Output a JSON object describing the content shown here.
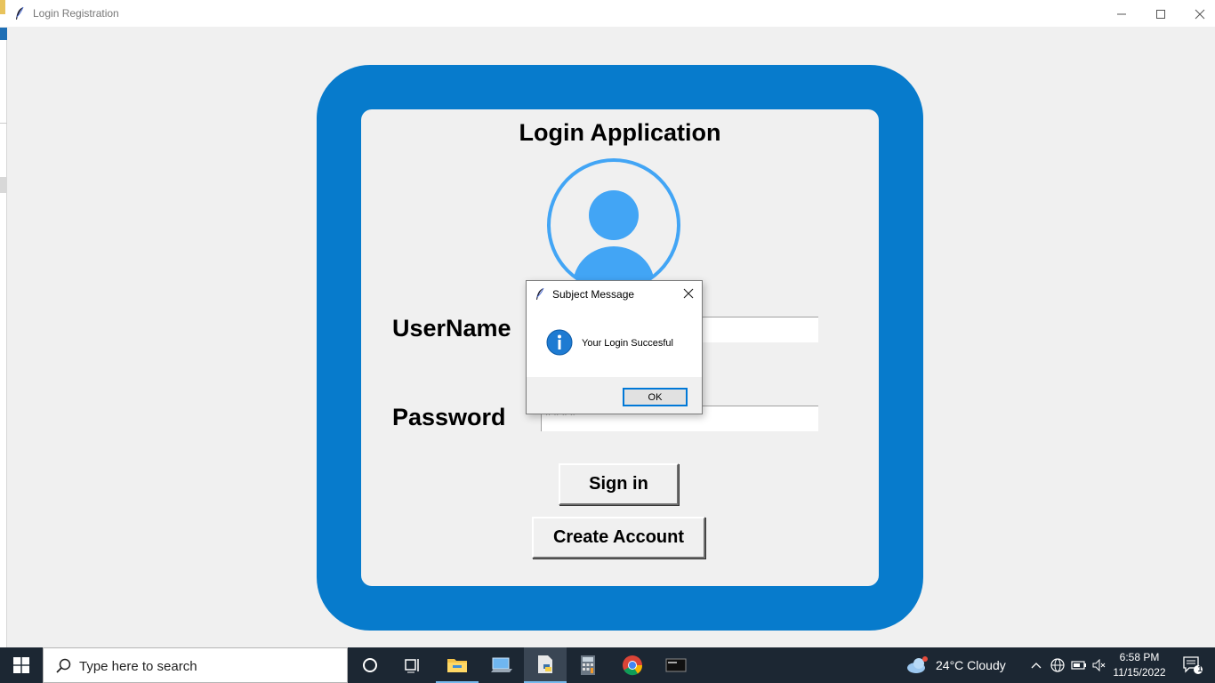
{
  "window": {
    "title": "Login Registration"
  },
  "app": {
    "heading": "Login Application",
    "username_label": "UserName",
    "password_label": "Password",
    "username_value": "",
    "password_value": "****",
    "signin_label": "Sign in",
    "create_label": "Create Account"
  },
  "dialog": {
    "title": "Subject Message",
    "message": "Your Login Succesful",
    "ok_label": "OK"
  },
  "taskbar": {
    "search_placeholder": "Type here to search",
    "weather": "24°C  Cloudy",
    "time": "6:58 PM",
    "date": "11/15/2022",
    "notification_count": "1"
  },
  "colors": {
    "frame_blue": "#077bcc",
    "avatar_blue": "#42a5f5",
    "taskbar": "#1c2733"
  }
}
